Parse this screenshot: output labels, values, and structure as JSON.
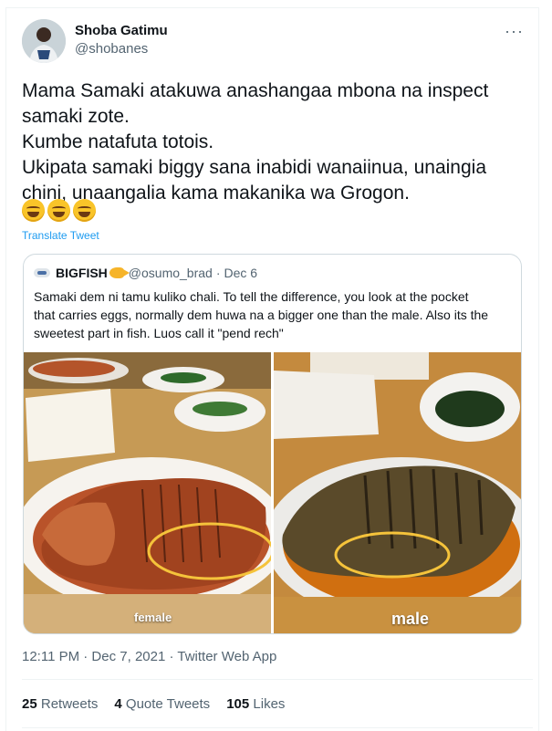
{
  "author": {
    "name": "Shoba Gatimu",
    "handle": "@shobanes"
  },
  "more_icon": "more-horizontal-icon",
  "tweet": {
    "lines": [
      "Mama Samaki atakuwa anashangaa mbona na inspect",
      "samaki zote.",
      "Kumbe natafuta totois.",
      "Ukipata samaki biggy sana inabidi wanaiinua, unaingia",
      "chini, unaangalia kama makanika wa Grogon."
    ],
    "emojis": [
      "rolling-on-floor-laughing-emoji",
      "rolling-on-floor-laughing-emoji",
      "rolling-on-floor-laughing-emoji"
    ],
    "translate_label": "Translate Tweet"
  },
  "quote": {
    "name": "BIGFISH",
    "handle": "@osumo_brad",
    "separator": "·",
    "date": "Dec 6",
    "lines": [
      "Samaki dem ni tamu kuliko chali. To tell the difference, you look at the pocket",
      "that carries eggs, normally dem huwa na a bigger one than the male. Also its the",
      "sweetest part in fish. Luos call it \"pend rech\""
    ],
    "photos": [
      {
        "label": "female"
      },
      {
        "label": "male"
      }
    ]
  },
  "meta": {
    "timestamp": "12:11 PM · Dec 7, 2021 · Twitter Web App"
  },
  "stats": [
    {
      "count": "25",
      "label": "Retweets"
    },
    {
      "count": "4",
      "label": "Quote Tweets"
    },
    {
      "count": "105",
      "label": "Likes"
    }
  ],
  "colors": {
    "accent": "#1d9bf0",
    "secondary_text": "#536471",
    "circle_annotation": "#f5c33b"
  }
}
